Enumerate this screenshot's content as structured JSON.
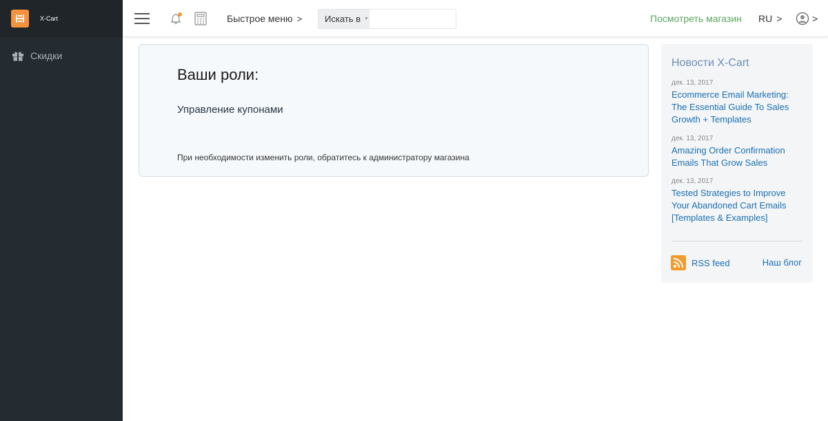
{
  "sidebar": {
    "brand": "X-Cart",
    "items": [
      {
        "label": "Скидки",
        "icon": "gift-icon"
      }
    ]
  },
  "topbar": {
    "quick_menu_label": "Быстрое меню",
    "search_select_label": "Искать в",
    "search_placeholder": "",
    "view_store_label": "Посмотреть магазин",
    "lang_label": "RU",
    "chevron": ">"
  },
  "roles": {
    "title": "Ваши роли:",
    "items": [
      "Управление купонами"
    ],
    "note": "При необходимости изменить роли, обратитесь к администратору магазина"
  },
  "news": {
    "title": "Новости X-Cart",
    "items": [
      {
        "date": "дек. 13, 2017",
        "title": "Ecommerce Email Marketing: The Essential Guide To Sales Growth + Templates"
      },
      {
        "date": "дек. 13, 2017",
        "title": "Amazing Order Confirmation Emails That Grow Sales"
      },
      {
        "date": "дек. 13, 2017",
        "title": "Tested Strategies to Improve Your Abandoned Cart Emails [Templates & Examples]"
      }
    ],
    "rss_label": "RSS feed",
    "blog_label": "Наш блог"
  },
  "colors": {
    "sidebar_bg": "#252c31",
    "accent_orange": "#f5923e",
    "store_link_green": "#5aa45e",
    "link_blue": "#1a6fb3",
    "notification_dot": "#f5923e"
  }
}
